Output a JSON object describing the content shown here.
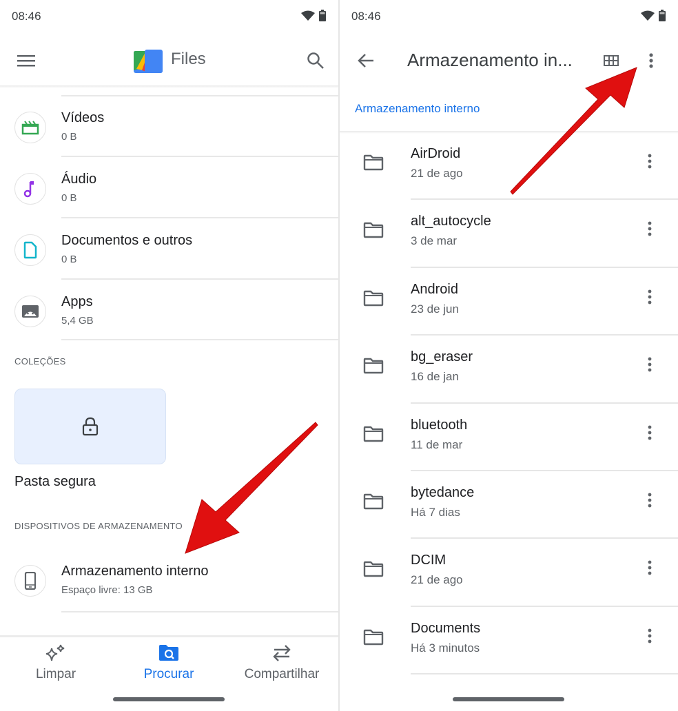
{
  "left_screen": {
    "status": {
      "time": "08:46"
    },
    "appbar": {
      "title": "Files",
      "menu_icon": "hamburger-icon",
      "search_icon": "search-icon"
    },
    "categories": [
      {
        "title": "Vídeos",
        "size": "0 B",
        "icon": "video-clapper-icon",
        "color": "#34a853"
      },
      {
        "title": "Áudio",
        "size": "0 B",
        "icon": "music-note-icon",
        "color": "#9334e6"
      },
      {
        "title": "Documentos e outros",
        "size": "0 B",
        "icon": "document-icon",
        "color": "#12b5cb"
      },
      {
        "title": "Apps",
        "size": "5,4 GB",
        "icon": "android-app-icon",
        "color": "#5f6368"
      }
    ],
    "collections": {
      "label": "COLEÇÕES",
      "safe_folder": "Pasta segura"
    },
    "storage_devices": {
      "label": "DISPOSITIVOS DE ARMAZENAMENTO",
      "items": [
        {
          "title": "Armazenamento interno",
          "subtitle": "Espaço livre: 13 GB",
          "icon": "phone-icon"
        }
      ]
    },
    "bottom_nav": [
      {
        "label": "Limpar",
        "icon": "sparkle-icon",
        "active": false
      },
      {
        "label": "Procurar",
        "icon": "folder-search-icon",
        "active": true
      },
      {
        "label": "Compartilhar",
        "icon": "swap-arrows-icon",
        "active": false
      }
    ]
  },
  "right_screen": {
    "status": {
      "time": "08:46"
    },
    "appbar": {
      "title": "Armazenamento in...",
      "back_icon": "arrow-back-icon",
      "grid_icon": "grid-view-icon",
      "more_icon": "more-vert-icon"
    },
    "breadcrumb": "Armazenamento interno",
    "folders": [
      {
        "name": "AirDroid",
        "date": "21 de ago"
      },
      {
        "name": "alt_autocycle",
        "date": "3 de mar"
      },
      {
        "name": "Android",
        "date": "23 de jun"
      },
      {
        "name": "bg_eraser",
        "date": "16 de jan"
      },
      {
        "name": "bluetooth",
        "date": "11 de mar"
      },
      {
        "name": "bytedance",
        "date": "Há 7 dias"
      },
      {
        "name": "DCIM",
        "date": "21 de ago"
      },
      {
        "name": "Documents",
        "date": "Há 3 minutos"
      }
    ]
  },
  "colors": {
    "accent": "#1a73e8",
    "annotation_arrow": "#e01010",
    "icon_gray": "#5f6368"
  }
}
